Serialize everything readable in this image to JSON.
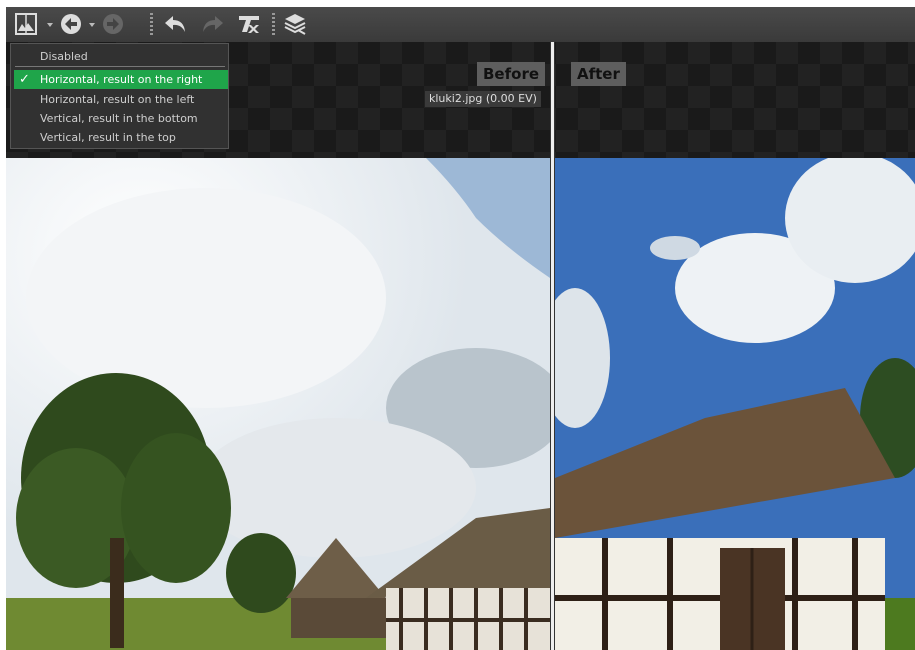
{
  "toolbar": {
    "icons": [
      "compare-view-icon",
      "back-icon",
      "forward-icon",
      "undo-icon",
      "redo-icon",
      "clear-edits-icon",
      "layers-icon"
    ]
  },
  "compare_menu": {
    "items": [
      {
        "label": "Disabled",
        "selected": false
      },
      {
        "label": "Horizontal, result on the right",
        "selected": true
      },
      {
        "label": "Horizontal, result on the left",
        "selected": false
      },
      {
        "label": "Vertical, result in the bottom",
        "selected": false
      },
      {
        "label": "Vertical, result in the top",
        "selected": false
      }
    ],
    "check_glyph": "✓"
  },
  "viewer": {
    "before_label": "Before",
    "after_label": "After",
    "file_info": "kluki2.jpg (0.00 EV)"
  },
  "colors": {
    "accent_selected": "#1fa54a",
    "toolbar_bg": "#444444",
    "menu_bg": "#323232"
  }
}
